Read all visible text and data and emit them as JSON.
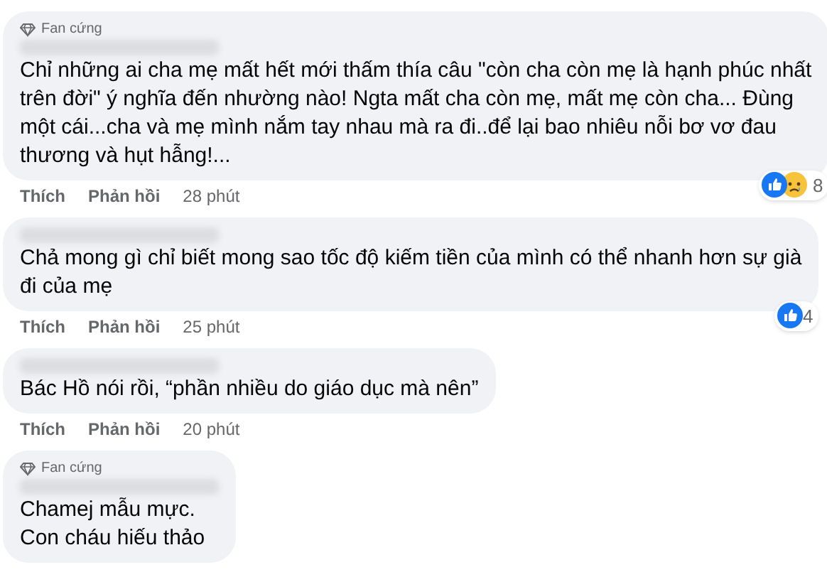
{
  "comments": [
    {
      "badge": "Fan cứng",
      "lines": [
        "Chỉ những ai cha mẹ mất hết mới thấm thía câu \"còn cha còn mẹ là hạnh phúc nhất",
        "trên đời\" ý nghĩa đến nhường nào! Ngta mất cha còn mẹ, mất mẹ còn cha... Đùng",
        "một cái...cha và mẹ mình nắm tay nhau mà ra đi..để lại bao nhiêu nỗi bơ vơ đau",
        "thương và hụt hẫng!..."
      ],
      "actions": [
        "Thích",
        "Phản hồi"
      ],
      "time": "28 phút",
      "reactions": {
        "icons": [
          {
            "kind": "like"
          },
          {
            "kind": "sad"
          }
        ],
        "count": "8"
      }
    },
    {
      "lines": [
        "Chả mong gì chỉ biết mong sao tốc độ kiếm tiền của mình có thể nhanh hơn sự già",
        "đi của mẹ"
      ],
      "actions": [
        "Thích",
        "Phản hồi"
      ],
      "time": "25 phút",
      "reactions": {
        "icons": [
          {
            "kind": "like"
          }
        ],
        "count": "4"
      }
    },
    {
      "lines": [
        "Bác Hồ nói rồi, “phần nhiều do giáo dục mà nên”"
      ],
      "actions": [
        "Thích",
        "Phản hồi"
      ],
      "time": "20 phút"
    },
    {
      "badge": "Fan cứng",
      "lines": [
        "Chamej mẫu mực.",
        "Con cháu hiếu thảo"
      ]
    }
  ]
}
